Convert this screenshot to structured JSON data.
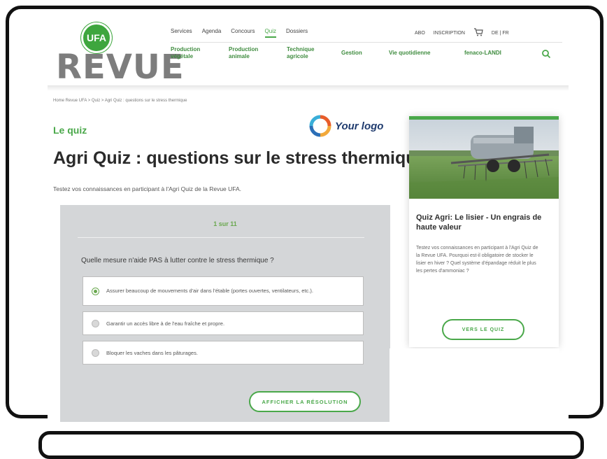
{
  "header": {
    "logo_text": "REVUE",
    "logo_badge": "UFA",
    "top_nav": [
      "Services",
      "Agenda",
      "Concours",
      "Quiz",
      "Dossiers"
    ],
    "top_nav_active": "Quiz",
    "abo": "ABO",
    "inscription": "INSCRIPTION",
    "languages": "DE | FR",
    "main_nav": [
      {
        "line1": "Production",
        "line2": "végétale"
      },
      {
        "line1": "Production",
        "line2": "animale"
      },
      {
        "line1": "Technique",
        "line2": "agricole"
      },
      {
        "line1": "Gestion",
        "line2": ""
      },
      {
        "line1": "Vie quotidienne",
        "line2": ""
      },
      {
        "line1": "fenaco-LANDI",
        "line2": ""
      }
    ]
  },
  "breadcrumb": "Home Revue UFA > Quiz > Agri Quiz : questions sur le stress thermique",
  "kicker": "Le quiz",
  "your_logo": "Your logo",
  "title": "Agri Quiz : questions sur le stress thermique",
  "intro": "Testez vos connaissances en participant à l'Agri Quiz de la Revue UFA.",
  "quiz": {
    "counter": "1 sur 11",
    "question": "Quelle mesure n'aide PAS à lutter contre le stress thermique ?",
    "options": [
      {
        "label": "Assurer beaucoup de mouvements d'air dans l'étable (portes ouvertes, ventilateurs, etc.).",
        "selected": true
      },
      {
        "label": "Garantir un accès libre à de l'eau fraîche et propre.",
        "selected": false
      },
      {
        "label": "Bloquer les vaches dans les pâturages.",
        "selected": false
      }
    ],
    "resolve_button": "AFFICHER LA RÉSOLUTION"
  },
  "card": {
    "title": "Quiz Agri: Le lisier - Un engrais de haute valeur",
    "text": "Testez vos connaissances en participant à l'Agri Quiz de la Revue UFA. Pourquoi est-il obligatoire de stocker le lisier en hiver ? Quel système d'épandage réduit le plus les pertes d'ammoniac ?",
    "button": "VERS LE QUIZ"
  },
  "colors": {
    "accent_green": "#4aa84a",
    "quiz_panel": "#d4d6d8",
    "title_text": "#2a2a2a"
  }
}
